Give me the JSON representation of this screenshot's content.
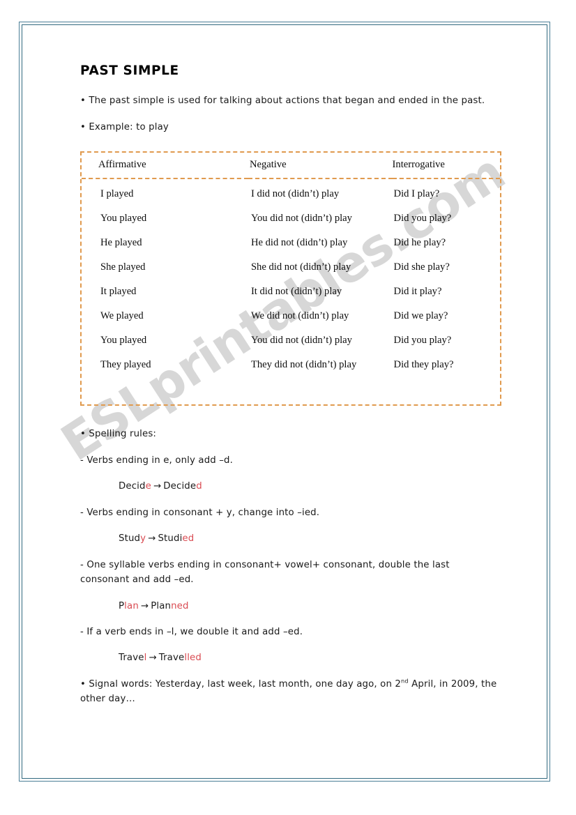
{
  "page": {
    "title": "PAST SIMPLE",
    "frame_color": "#31697f",
    "watermark": "ESLprintables.com",
    "watermark_color": "#c9c9c9",
    "accent_red": "#d94b52",
    "table_border_color": "#e09a4e"
  },
  "intro": {
    "definition": "• The past simple is used for talking about actions that began and ended in the past.",
    "example": "• Example: to play"
  },
  "conjugation": {
    "headers": [
      "Affirmative",
      "Negative",
      "Interrogative"
    ],
    "rows": [
      [
        "I played",
        "I did not (didn’t) play",
        "Did I play?"
      ],
      [
        "You played",
        "You did not (didn’t) play",
        "Did you play?"
      ],
      [
        "He played",
        "He did not (didn’t) play",
        "Did he play?"
      ],
      [
        "She played",
        "She did not (didn’t) play",
        "Did she play?"
      ],
      [
        "It played",
        "It did not (didn’t) play",
        "Did it play?"
      ],
      [
        "We played",
        "We did not (didn’t) play",
        "Did we play?"
      ],
      [
        "You played",
        "You did not (didn’t) play",
        "Did you play?"
      ],
      [
        "They played",
        "They did not (didn’t) play",
        "Did they play?"
      ]
    ]
  },
  "spelling": {
    "heading": "• Spelling rules:",
    "rule1": "- Verbs ending in e, only add –d.",
    "example1": {
      "base_black": "Decid",
      "base_red": "e",
      "arrow": "→",
      "result_black": "Decide",
      "result_red": "d"
    },
    "rule2": "- Verbs ending in consonant + y, change into –ied.",
    "example2": {
      "base_black": "Stud",
      "base_red": "y",
      "arrow": "→",
      "result_black": "Studi",
      "result_red": "ed"
    },
    "rule3": "- One syllable verbs ending in consonant+ vowel+ consonant, double the last consonant and add –ed.",
    "example3": {
      "base_black": "P",
      "base_red": "lan",
      "arrow": "→",
      "result_black": "Plan",
      "result_red": "ned"
    },
    "rule4": "- If a verb ends in –l, we double it and add –ed.",
    "example4": {
      "base_black": "Trave",
      "base_red": "l",
      "arrow": "→",
      "result_black": "Trave",
      "result_red": "lled"
    }
  },
  "signal": {
    "prefix": "• Signal words: Yesterday, last week, last month, one day ago, on 2",
    "ordinal": "nd",
    "suffix": " April, in 2009, the other day…"
  }
}
